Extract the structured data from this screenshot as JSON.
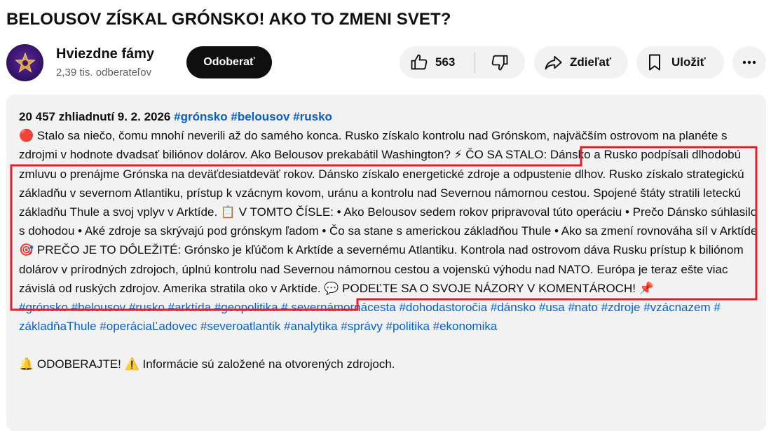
{
  "video": {
    "title": "BELOUSOV ZÍSKAL GRÓNSKO! AKO TO ZMENI SVET?"
  },
  "channel": {
    "name": "Hviezdne fámy",
    "subscribers": "2,39 tis. odberateľov",
    "subscribe_label": "Odoberať"
  },
  "actions": {
    "like_count": "563",
    "share_label": "Zdieľať",
    "save_label": "Uložiť"
  },
  "description": {
    "views_date": "20 457 zhliadnutí  9. 2. 2026",
    "header_tags": "#grónsko #belousov #rusko",
    "text_1": " Stalo sa niečo, čomu mnohí neverili až do samého konca. Rusko získalo kontrolu nad Grónskom, najväčším ostrovom na planéte s zdrojmi v hodnote dvadsať biliónov dolárov. Ako Belousov prekabátil Washington? ",
    "text_2": " ČO SA STALO: Dánsko a Rusko podpísali dlhodobú zmluvu o prenájme Grónska na deväťdesiatdeväť rokov. Dánsko získalo energetické zdroje a odpustenie dlhov. Rusko získalo strategickú základňu v severnom Atlantiku, prístup k vzácnym kovom, uránu a kontrolu nad Severnou námornou cestou. Spojené štáty stratili leteckú základňu Thule a svoj vplyv v Arktíde. ",
    "text_3": " V TOMTO ČÍSLE: • Ako Belousov sedem rokov pripravoval túto operáciu • Prečo Dánsko súhlasilo s dohodou • Aké zdroje sa skrývajú pod grónskym ľadom • Čo sa stane s americkou základňou Thule • Ako sa zmení rovnováha síl v Arktíde ",
    "text_4": " PREČO JE TO DÔLEŽITÉ: Grónsko je kľúčom k Arktíde a severnému Atlantiku. Kontrola nad ostrovom dáva Rusku prístup k biliónom dolárov v prírodných zdrojoch, úplnú kontrolu nad Severnou námornou cestou a vojenskú výhodu nad NATO. Európa je teraz ešte viac závislá od ruských zdrojov. Amerika stratila oko v Arktíde. ",
    "text_5": " PODEĽTE SA O SVOJE NÁZORY V KOMENTÁROCH! ",
    "hashtags": "#grónsko #belousov #rusko #arktída #geopolitika # severnámornácesta #dohodastoročia #dánsko #usa #nato #zdroje #vzácnazem # základňaThule #operáciaĽadovec #severoatlantik #analytika #správy #politika #ekonomika",
    "footer_1": " ODOBERAJTE! ",
    "footer_2": " Informácie sú založené na otvorených zdrojoch."
  },
  "icons": {
    "red_circle": "red-circle-emoji",
    "lightning": "high-voltage-emoji",
    "clipboard": "clipboard-emoji",
    "target": "direct-hit-emoji",
    "speech": "speech-balloon-emoji",
    "pin": "pushpin-emoji",
    "bell": "bell-emoji",
    "warning": "warning-emoji"
  },
  "colors": {
    "link": "#065fd4",
    "subscribe_bg": "#0f0f0f",
    "pill_bg": "#f2f2f2",
    "highlight_box": "#e0202a"
  }
}
